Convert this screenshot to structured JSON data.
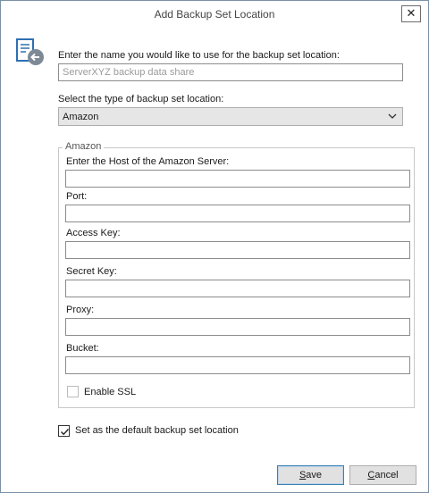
{
  "window": {
    "title": "Add Backup Set Location",
    "close_glyph": "✕"
  },
  "icon": "backup-location-icon",
  "name_field": {
    "label": "Enter the name you would like to use for the backup set location:",
    "value": "",
    "placeholder": "ServerXYZ backup data share"
  },
  "type_field": {
    "label": "Select the type of backup set location:",
    "selected": "Amazon"
  },
  "amazon_group": {
    "legend": "Amazon",
    "fields": [
      {
        "label": "Enter the Host of the Amazon Server:",
        "value": ""
      },
      {
        "label": "Port:",
        "value": ""
      },
      {
        "label": "Access Key:",
        "value": ""
      },
      {
        "label": "Secret Key:",
        "value": ""
      },
      {
        "label": "Proxy:",
        "value": ""
      },
      {
        "label": "Bucket:",
        "value": ""
      }
    ],
    "enable_ssl": {
      "label": "Enable SSL",
      "checked": false
    }
  },
  "default_location": {
    "label": "Set as the default backup set location",
    "checked": true
  },
  "buttons": {
    "save": {
      "mnemonic": "S",
      "rest": "ave"
    },
    "cancel": {
      "mnemonic": "C",
      "rest": "ancel"
    }
  },
  "colors": {
    "accent": "#3c7fb1",
    "icon_blue": "#2e6fb3"
  }
}
